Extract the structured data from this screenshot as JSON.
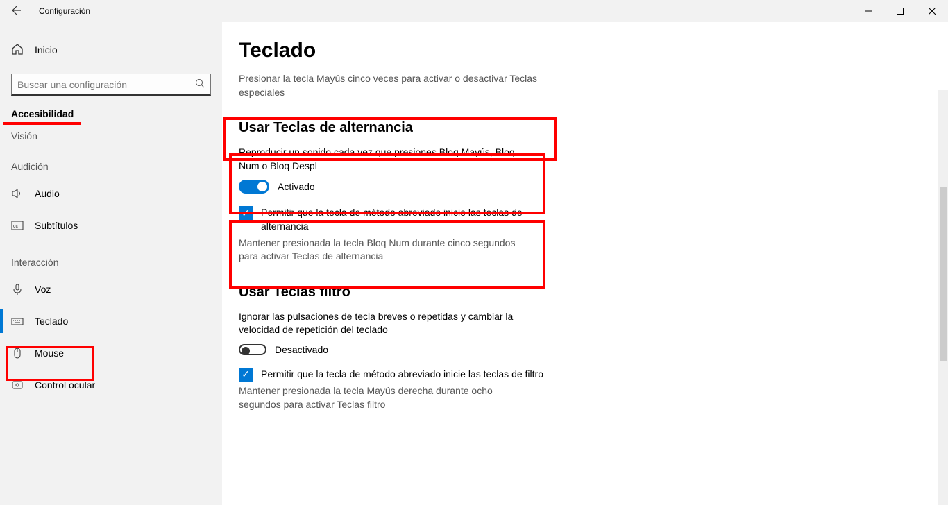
{
  "titlebar": {
    "app_name": "Configuración"
  },
  "sidebar": {
    "home": "Inicio",
    "search_placeholder": "Buscar una configuración",
    "group": "Accesibilidad",
    "group_sub": "Visión",
    "section_audicion": "Audición",
    "audio": "Audio",
    "subtitulos": "Subtítulos",
    "section_interaccion": "Interacción",
    "voz": "Voz",
    "teclado": "Teclado",
    "mouse": "Mouse",
    "control_ocular": "Control ocular"
  },
  "main": {
    "page_title": "Teclado",
    "sticky_hint": "Presionar la tecla Mayús cinco veces para activar o desactivar Teclas especiales",
    "toggle_keys": {
      "heading": "Usar Teclas de alternancia",
      "desc": "Reproducir un sonido cada vez que presiones Bloq Mayús, Bloq Num o Bloq Despl",
      "state": "Activado",
      "checkbox_label": "Permitir que la tecla de método abreviado inicie las teclas de alternancia",
      "checkbox_hint": "Mantener presionada la tecla Bloq Num durante cinco segundos para activar Teclas de alternancia"
    },
    "filter_keys": {
      "heading": "Usar Teclas filtro",
      "desc": "Ignorar las pulsaciones de tecla breves o repetidas y cambiar la velocidad de repetición del teclado",
      "state": "Desactivado",
      "checkbox_label": "Permitir que la tecla de método abreviado inicie las teclas de filtro",
      "checkbox_hint": "Mantener presionada la tecla Mayús derecha durante ocho segundos para activar Teclas filtro"
    }
  }
}
